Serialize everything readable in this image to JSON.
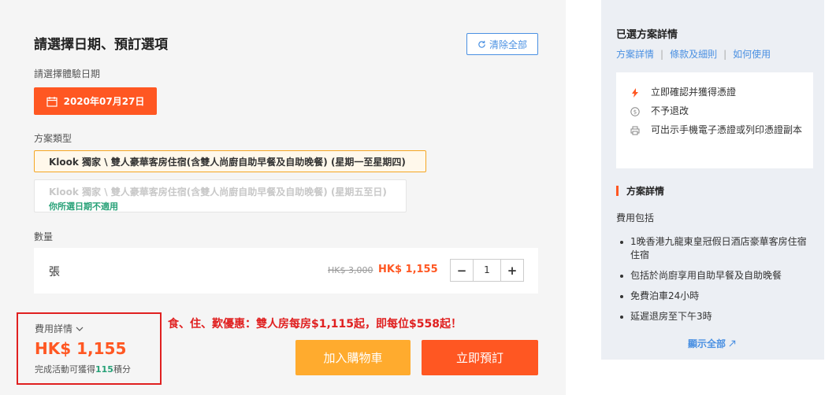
{
  "booking": {
    "title": "請選擇日期、預訂選項",
    "clear_all": "清除全部",
    "date_label": "請選擇體驗日期",
    "selected_date": "2020年07月27日",
    "package_label": "方案類型",
    "packages": [
      {
        "title": "Klook 獨家 \\ 雙人豪華客房住宿(含雙人尚廚自助早餐及自助晚餐) (星期一至星期四)",
        "note": ""
      },
      {
        "title": "Klook 獨家 \\ 雙人豪華客房住宿(含雙人尚廚自助早餐及自助晚餐) (星期五至日)",
        "note": "你所選日期不適用"
      }
    ],
    "quantity_label": "數量",
    "quantity": {
      "unit": "張",
      "old_price": "HK$ 3,000",
      "price": "HK$ 1,155",
      "minus": "−",
      "value": "1",
      "plus": "+"
    },
    "fee": {
      "label": "費用詳情",
      "total": "HK$ 1,155",
      "points_prefix": "完成活動可獲得",
      "points": "115",
      "points_suffix": "積分"
    },
    "promo": "食、住、歎優惠：雙人房每房$1,115起，即每位$558起！",
    "add_to_cart": "加入購物車",
    "book_now": "立即預訂"
  },
  "details": {
    "title": "已選方案詳情",
    "links": [
      "方案詳情",
      "條款及細則",
      "如何使用"
    ],
    "features": [
      {
        "icon": "lightning-icon",
        "text": "立即確認并獲得憑證"
      },
      {
        "icon": "dollar-circle-icon",
        "text": "不予退改"
      },
      {
        "icon": "printer-icon",
        "text": "可出示手機電子憑證或列印憑證副本"
      }
    ],
    "section_title": "方案詳情",
    "fee_includes": "費用包括",
    "includes": [
      "1晚香港九龍東皇冠假日酒店豪華客房住宿住宿",
      "包括於尚廚享用自助早餐及自助晚餐",
      "免費泊車24小時",
      "延遲退房至下午3時"
    ],
    "show_all": "顯示全部"
  },
  "colors": {
    "accent": "#ff5722",
    "cart": "#ffab2e",
    "link": "#4a90e2",
    "highlight": "#e02020",
    "green": "#27a177"
  }
}
